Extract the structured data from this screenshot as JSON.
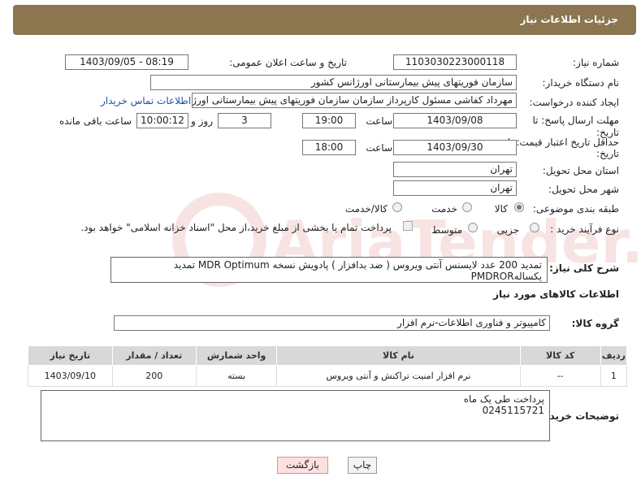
{
  "header": {
    "title": "جزئیات اطلاعات نیاز"
  },
  "form": {
    "need_number_label": "شماره نیاز:",
    "need_number": "1103030223000118",
    "announce_label": "تاریخ و ساعت اعلان عمومی:",
    "announce_value": "1403/09/05 - 08:19",
    "buyer_org_label": "نام دستگاه خریدار:",
    "buyer_org": "سازمان فوریتهای پیش بیمارستانی اورژانس کشور",
    "creator_label": "ایجاد کننده درخواست:",
    "creator": "مهرداد کفاشی مسئول کارپرداز سازمان سازمان فوریتهای پیش بیمارستانی اورژا",
    "contact_link": "اطلاعات تماس خریدار",
    "deadline_label": "مهلت ارسال پاسخ: تا",
    "deadline_label2": "تاریخ:",
    "deadline_date": "1403/09/08",
    "time_label": "ساعت",
    "deadline_time": "19:00",
    "days_value": "3",
    "days_label": "روز و",
    "remaining_time": "10:00:12",
    "remaining_label": "ساعت باقی مانده",
    "validity_label": "حداقل تاریخ اعتبار قیمت: تا",
    "validity_label2": "تاریخ:",
    "validity_date": "1403/09/30",
    "validity_time": "18:00",
    "province_label": "استان محل تحویل:",
    "province": "تهران",
    "city_label": "شهر محل تحویل:",
    "city": "تهران",
    "category_label": "طبقه بندی موضوعی:",
    "category_options": [
      "کالا",
      "خدمت",
      "کالا/خدمت"
    ],
    "process_label": "نوع فرآیند خرید :",
    "process_options": [
      "جزیی",
      "متوسط"
    ],
    "payment_note": "پرداخت تمام یا بخشی از مبلغ خرید،از محل \"اسناد خزانه اسلامی\" خواهد بود."
  },
  "description": {
    "label": "شرح کلی نیاز:",
    "text": "تمدید 200 عدد لایسنس آنتی ویروس ( ضد بدافزار ) پادویش نسخه MDR Optimum تمدید یکسالهPMDROR"
  },
  "goods": {
    "section_title": "اطلاعات کالاهای مورد نیاز",
    "group_label": "گروه کالا:",
    "group_value": "کامپیوتر و فناوری اطلاعات-نرم افزار",
    "columns": [
      "ردیف",
      "کد کالا",
      "نام کالا",
      "واحد شمارش",
      "تعداد / مقدار",
      "تاریخ نیاز"
    ],
    "rows": [
      [
        "1",
        "--",
        "نرم افزار امنیت تراکنش و آنتی ویروس",
        "بسته",
        "200",
        "1403/09/10"
      ]
    ]
  },
  "notes": {
    "label": "توضیحات خریدار:",
    "line1": "پرداخت طی یک ماه",
    "line2": "0245115721"
  },
  "buttons": {
    "print": "چاپ",
    "back": "بازگشت"
  },
  "watermark": {
    "text": "AriaTender.net"
  }
}
